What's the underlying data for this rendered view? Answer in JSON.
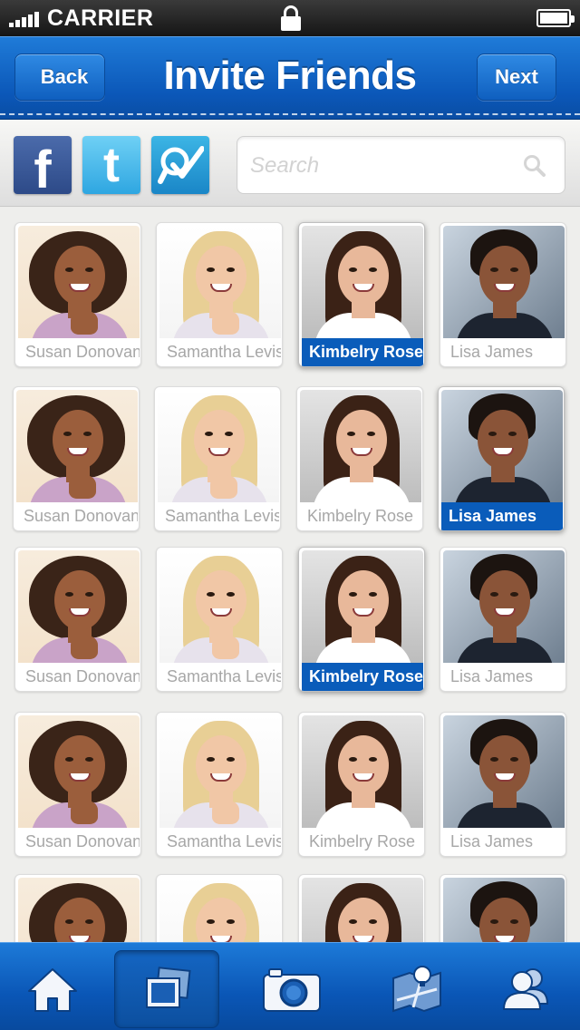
{
  "status_bar": {
    "carrier": "CARRIER"
  },
  "nav": {
    "title": "Invite Friends",
    "back_label": "Back",
    "next_label": "Next"
  },
  "share": {
    "facebook_glyph": "f",
    "twitter_glyph": "t",
    "foursquare_icon": "foursquare-check-icon"
  },
  "search": {
    "placeholder": "Search",
    "icon": "search-icon"
  },
  "friends": {
    "rows": [
      [
        {
          "name": "Susan Donovan",
          "selected": false
        },
        {
          "name": "Samantha Levis",
          "selected": false
        },
        {
          "name": "Kimbelry Rose",
          "selected": true
        },
        {
          "name": "Lisa James",
          "selected": false
        }
      ],
      [
        {
          "name": "Susan Donovan",
          "selected": false
        },
        {
          "name": "Samantha Levis",
          "selected": false
        },
        {
          "name": "Kimbelry Rose",
          "selected": false
        },
        {
          "name": "Lisa James",
          "selected": true
        }
      ],
      [
        {
          "name": "Susan Donovan",
          "selected": false
        },
        {
          "name": "Samantha Levis",
          "selected": false
        },
        {
          "name": "Kimbelry Rose",
          "selected": true
        },
        {
          "name": "Lisa James",
          "selected": false
        }
      ],
      [
        {
          "name": "Susan Donovan",
          "selected": false
        },
        {
          "name": "Samantha Levis",
          "selected": false
        },
        {
          "name": "Kimbelry Rose",
          "selected": false
        },
        {
          "name": "Lisa James",
          "selected": false
        }
      ],
      [
        {
          "name": "",
          "selected": false
        },
        {
          "name": "",
          "selected": false
        },
        {
          "name": "",
          "selected": false
        },
        {
          "name": "",
          "selected": false
        }
      ]
    ]
  },
  "tab_bar": {
    "items": [
      {
        "icon": "home-icon",
        "active": false
      },
      {
        "icon": "photo-gallery-icon",
        "active": true
      },
      {
        "icon": "camera-icon",
        "active": false
      },
      {
        "icon": "map-lightbulb-icon",
        "active": false
      },
      {
        "icon": "contacts-icon",
        "active": false
      }
    ]
  },
  "colors": {
    "brand_blue": "#0b57b8",
    "selected_label": "#0a5cba",
    "facebook": "#3b5998",
    "twitter": "#4cc0ee",
    "foursquare": "#2596d6"
  }
}
